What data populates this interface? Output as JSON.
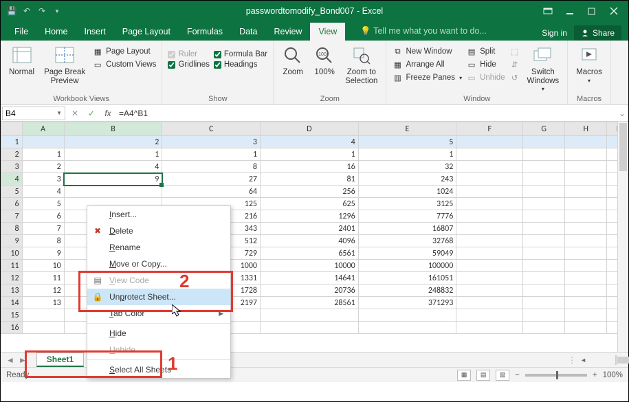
{
  "title": "passwordtomodify_Bond007 - Excel",
  "menus": {
    "file": "File",
    "home": "Home",
    "insert": "Insert",
    "pagelayout": "Page Layout",
    "formulas": "Formulas",
    "data": "Data",
    "review": "Review",
    "view": "View",
    "tellme": "Tell me what you want to do...",
    "signin": "Sign in",
    "share": "Share"
  },
  "ribbon": {
    "workbook_views": {
      "label": "Workbook Views",
      "normal": "Normal",
      "pagebreak": "Page Break\nPreview",
      "pagelayout": "Page Layout",
      "custom": "Custom Views"
    },
    "show": {
      "label": "Show",
      "ruler": "Ruler",
      "formulabar": "Formula Bar",
      "gridlines": "Gridlines",
      "headings": "Headings"
    },
    "zoom": {
      "label": "Zoom",
      "zoom": "Zoom",
      "hundred": "100%",
      "zoomsel": "Zoom to\nSelection"
    },
    "window": {
      "label": "Window",
      "new": "New Window",
      "arrange": "Arrange All",
      "freeze": "Freeze Panes",
      "split": "Split",
      "hide": "Hide",
      "unhide": "Unhide",
      "switch": "Switch\nWindows"
    },
    "macros": {
      "label": "Macros",
      "macros": "Macros"
    }
  },
  "namebox": "B4",
  "formula": "=A4^B1",
  "columns": [
    "A",
    "B",
    "C",
    "D",
    "E",
    "F",
    "G",
    "H",
    "I"
  ],
  "rows": [
    {
      "n": 1,
      "A": "",
      "B": "2",
      "C": "3",
      "D": "4",
      "E": "5",
      "F": "",
      "G": "",
      "H": ""
    },
    {
      "n": 2,
      "A": "1",
      "B": "1",
      "C": "1",
      "D": "1",
      "E": "1",
      "F": "",
      "G": "",
      "H": ""
    },
    {
      "n": 3,
      "A": "2",
      "B": "4",
      "C": "8",
      "D": "16",
      "E": "32",
      "F": "",
      "G": "",
      "H": ""
    },
    {
      "n": 4,
      "A": "3",
      "B": "9",
      "C": "27",
      "D": "81",
      "E": "243",
      "F": "",
      "G": "",
      "H": ""
    },
    {
      "n": 5,
      "A": "4",
      "B": "",
      "C": "64",
      "D": "256",
      "E": "1024",
      "F": "",
      "G": "",
      "H": ""
    },
    {
      "n": 6,
      "A": "5",
      "B": "",
      "C": "125",
      "D": "625",
      "E": "3125",
      "F": "",
      "G": "",
      "H": ""
    },
    {
      "n": 7,
      "A": "6",
      "B": "",
      "C": "216",
      "D": "1296",
      "E": "7776",
      "F": "",
      "G": "",
      "H": ""
    },
    {
      "n": 8,
      "A": "7",
      "B": "",
      "C": "343",
      "D": "2401",
      "E": "16807",
      "F": "",
      "G": "",
      "H": ""
    },
    {
      "n": 9,
      "A": "8",
      "B": "",
      "C": "512",
      "D": "4096",
      "E": "32768",
      "F": "",
      "G": "",
      "H": ""
    },
    {
      "n": 10,
      "A": "9",
      "B": "",
      "C": "729",
      "D": "6561",
      "E": "59049",
      "F": "",
      "G": "",
      "H": ""
    },
    {
      "n": 11,
      "A": "10",
      "B": "",
      "C": "1000",
      "D": "10000",
      "E": "100000",
      "F": "",
      "G": "",
      "H": ""
    },
    {
      "n": 12,
      "A": "11",
      "B": "",
      "C": "1331",
      "D": "14641",
      "E": "161051",
      "F": "",
      "G": "",
      "H": ""
    },
    {
      "n": 13,
      "A": "12",
      "B": "",
      "C": "1728",
      "D": "20736",
      "E": "248832",
      "F": "",
      "G": "",
      "H": ""
    },
    {
      "n": 14,
      "A": "13",
      "B": "",
      "C": "2197",
      "D": "28561",
      "E": "371293",
      "F": "",
      "G": "",
      "H": ""
    },
    {
      "n": 15,
      "A": "",
      "B": "",
      "C": "",
      "D": "",
      "E": "",
      "F": "",
      "G": "",
      "H": ""
    },
    {
      "n": 16,
      "A": "",
      "B": "",
      "C": "",
      "D": "",
      "E": "",
      "F": "",
      "G": "",
      "H": ""
    }
  ],
  "context_menu": {
    "insert": "Insert...",
    "delete": "Delete",
    "rename": "Rename",
    "move": "Move or Copy...",
    "viewcode": "View Code",
    "unprotect": "Unprotect Sheet...",
    "tabcolor": "Tab Color",
    "hide": "Hide",
    "unhide": "Unhide",
    "selectall": "Select All Sheets"
  },
  "sheet_tab": "Sheet1",
  "status": {
    "ready": "Ready",
    "zoom": "100%"
  },
  "annotations": {
    "one": "1",
    "two": "2"
  }
}
